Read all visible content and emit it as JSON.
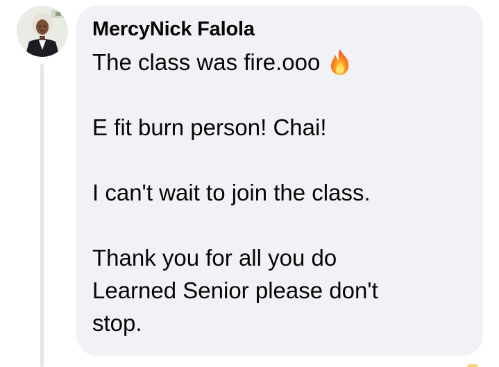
{
  "comment": {
    "author": "MercyNick Falola",
    "paragraphs": [
      "The class was fire.ooo",
      "E fit burn person! Chai!",
      "I can't wait to join the class.",
      "Thank you for all you do",
      "Learned Senior please don't",
      "stop."
    ],
    "emoji": "fire-icon"
  },
  "colors": {
    "bubble_background": "#f0f2f5",
    "text": "#050505",
    "thread_line": "#e4e6eb"
  }
}
